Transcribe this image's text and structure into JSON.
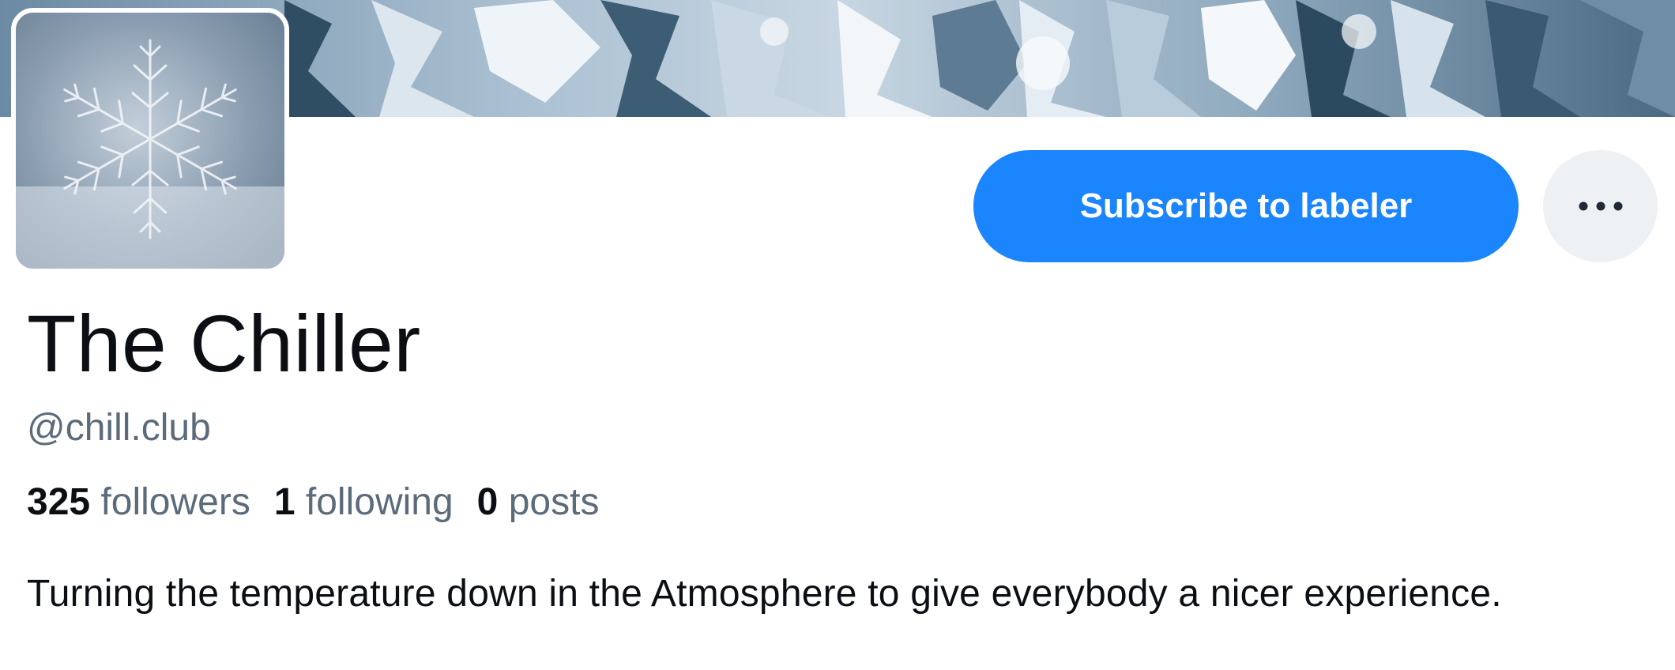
{
  "profile": {
    "display_name": "The Chiller",
    "handle": "@chill.club",
    "bio": "Turning the temperature down in the Atmosphere to give everybody a nicer experience."
  },
  "stats": {
    "followers_count": "325",
    "followers_label": "followers",
    "following_count": "1",
    "following_label": "following",
    "posts_count": "0",
    "posts_label": "posts"
  },
  "actions": {
    "subscribe_label": "Subscribe to labeler",
    "more_icon": "ellipsis-icon"
  },
  "images": {
    "banner": "icy-banner",
    "avatar": "snowflake-icon"
  },
  "colors": {
    "accent": "#1a85fc",
    "text_primary": "#0b0f14",
    "text_secondary": "#5c6b7a",
    "more_button_bg": "#eef1f4"
  }
}
